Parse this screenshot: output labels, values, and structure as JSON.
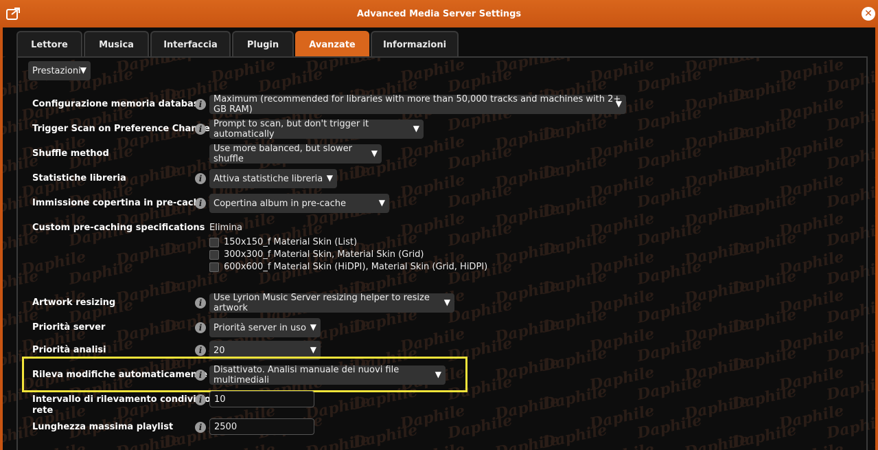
{
  "window": {
    "title": "Advanced Media Server Settings"
  },
  "tabs": [
    {
      "label": "Lettore"
    },
    {
      "label": "Musica"
    },
    {
      "label": "Interfaccia"
    },
    {
      "label": "Plugin"
    },
    {
      "label": "Avanzate",
      "active": true
    },
    {
      "label": "Informazioni"
    }
  ],
  "section_select": {
    "value": "Prestazioni"
  },
  "watermark_text": "Daphile",
  "settings": {
    "db_memory": {
      "label": "Configurazione memoria database",
      "value": "Maximum (recommended for libraries with more than 50,000 tracks and machines with 2+ GB RAM)"
    },
    "trigger_scan": {
      "label": "Trigger Scan on Preference Changes",
      "value": "Prompt to scan, but don't trigger it automatically"
    },
    "shuffle": {
      "label": "Shuffle method",
      "value": "Use more balanced, but slower shuffle"
    },
    "library_stats": {
      "label": "Statistiche libreria",
      "value": "Attiva statistiche libreria"
    },
    "precache_cover": {
      "label": "Immissione copertina in pre-cache",
      "value": "Copertina album in pre-cache"
    },
    "custom_precache": {
      "label": "Custom pre-caching specifications",
      "delete_label": "Elimina",
      "options": [
        {
          "label": "150x150_f Material Skin (List)",
          "checked": false
        },
        {
          "label": "300x300_f Material Skin, Material Skin (Grid)",
          "checked": false
        },
        {
          "label": "600x600_f Material Skin (HiDPI), Material Skin (Grid, HiDPI)",
          "checked": false
        }
      ]
    },
    "artwork_resizing": {
      "label": "Artwork resizing",
      "value": "Use Lyrion Music Server resizing helper to resize artwork"
    },
    "server_priority": {
      "label": "Priorità  server",
      "value": "Priorità server in uso"
    },
    "scan_priority": {
      "label": "Priorità analisi",
      "value": "20"
    },
    "auto_detect": {
      "label": "Rileva modifiche automaticamente",
      "value": "Disattivato. Analisi manuale dei nuovi file multimediali"
    },
    "network_interval": {
      "label_line1": "Intervallo di rilevamento condivisione",
      "label_line2": "rete",
      "value": "10"
    },
    "playlist_max": {
      "label": "Lunghezza massima playlist",
      "value": "2500"
    }
  },
  "colors": {
    "accent": "#d9661c",
    "highlight": "#f2e43a",
    "background": "#0d0d0d"
  }
}
